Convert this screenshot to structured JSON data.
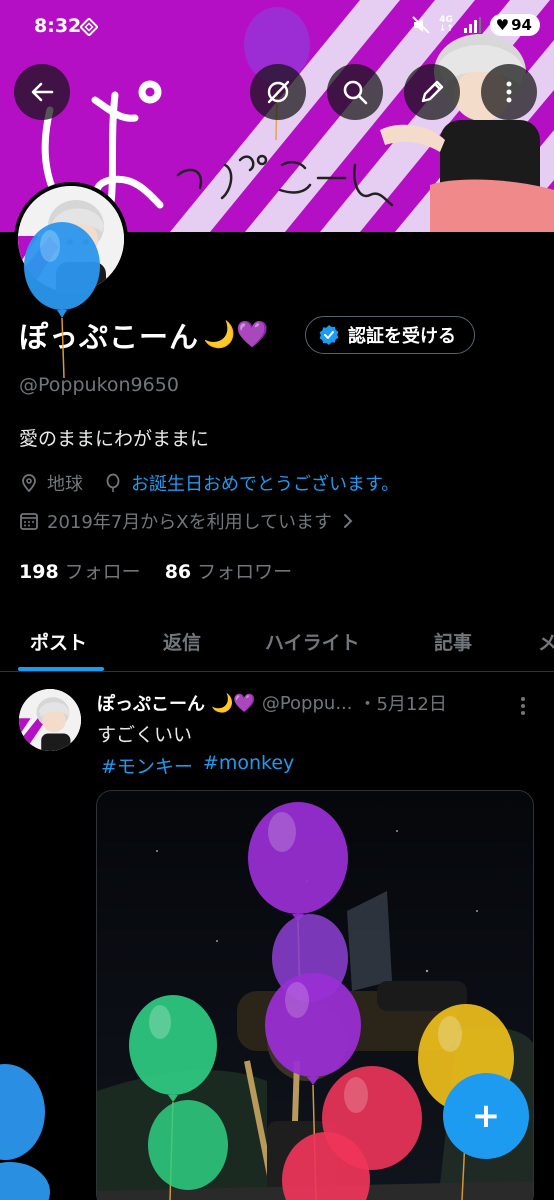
{
  "status_bar": {
    "time": "8:32",
    "network_top": "4G",
    "network_bottom": "↓↑",
    "battery": "94"
  },
  "banner": {
    "text": "ぽっぷこーん",
    "colors": {
      "magenta": "#b40fc4",
      "stripe": "#e8d9f4"
    }
  },
  "header_buttons": {
    "back": "arrow-left-icon",
    "grok": "grok-icon",
    "search": "search-icon",
    "compose": "pencil-icon",
    "more": "more-vertical-icon"
  },
  "profile": {
    "display_name": "ぽっぷこーん",
    "name_emoji": "🌙💜",
    "verify_button": "認証を受ける",
    "handle": "@Poppukon9650",
    "bio": "愛のままにわがままに",
    "location": "地球",
    "birthday_message": "お誕生日おめでとうございます。",
    "joined": "2019年7月からXを利用しています",
    "following_count": "198",
    "following_label": "フォロー",
    "followers_count": "86",
    "followers_label": "フォロワー"
  },
  "tabs": [
    {
      "label": "ポスト",
      "active": true
    },
    {
      "label": "返信",
      "active": false
    },
    {
      "label": "ハイライト",
      "active": false
    },
    {
      "label": "記事",
      "active": false
    },
    {
      "label": "メ",
      "active": false
    }
  ],
  "post": {
    "name": "ぽっぷこーん",
    "name_emoji": "🌙💜",
    "handle": "@Poppu...",
    "date": "・5月12日",
    "text": "すごくいい",
    "tags": [
      "#モンキー",
      "#monkey"
    ]
  },
  "fab": {
    "label": "+"
  },
  "colors": {
    "accent": "#1d9bf0",
    "muted": "#71767b",
    "background": "#000000"
  }
}
